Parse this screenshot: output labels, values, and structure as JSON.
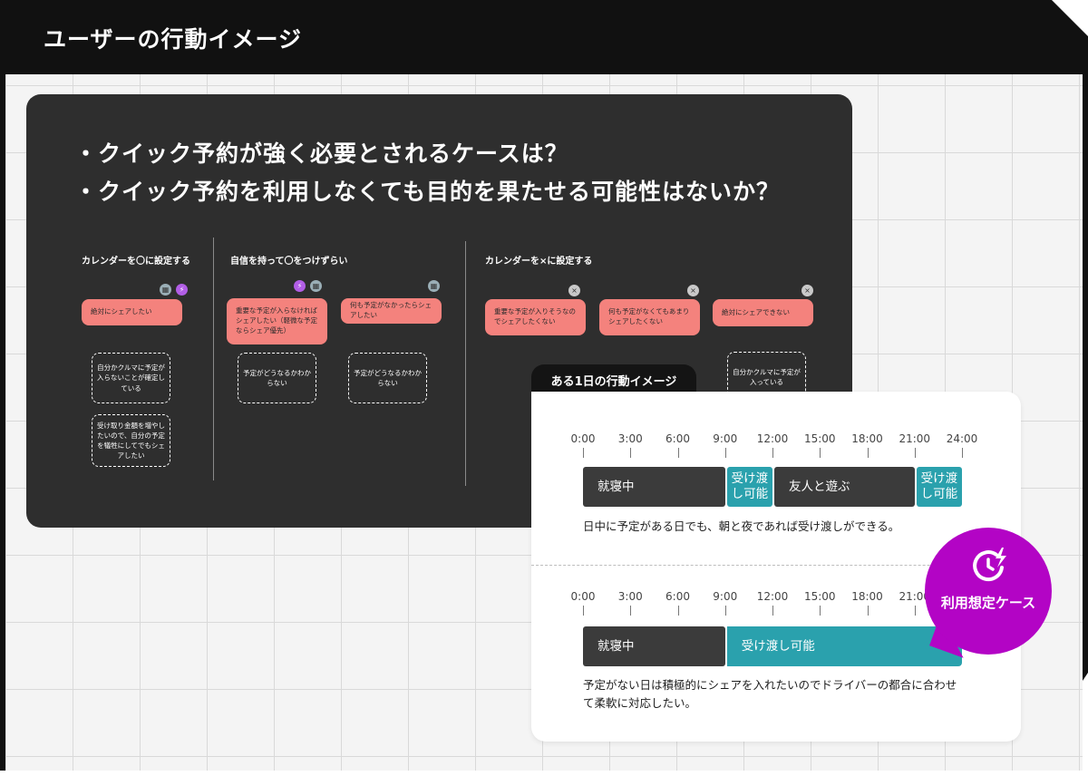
{
  "header": {
    "title": "ユーザーの行動イメージ"
  },
  "questions": [
    "・クイック予約が強く必要とされるケースは？",
    "・クイック予約を利用しなくても目的を果たせる可能性はないか？"
  ],
  "columns": [
    {
      "heading": "カレンダーを〇に設定する",
      "cards": [
        {
          "text": "絶対にシェアしたい"
        }
      ],
      "notes": [
        "自分かクルマに予定が入らないことが確定している",
        "受け取り金額を増やしたいので、自分の予定を犠牲にしてでもシェアしたい"
      ]
    },
    {
      "heading": "自信を持って〇をつけずらい",
      "cards": [
        {
          "text": "重要な予定が入らなければシェアしたい（軽微な予定ならシェア優先）"
        },
        {
          "text": "何も予定がなかったらシェアしたい"
        }
      ],
      "notes": [
        "予定がどうなるかわからない",
        "予定がどうなるかわからない"
      ]
    },
    {
      "heading": "カレンダーを×に設定する",
      "cards": [
        {
          "text": "重要な予定が入りそうなのでシェアしたくない"
        },
        {
          "text": "何も予定がなくてもあまりシェアしたくない"
        },
        {
          "text": "絶対にシェアできない"
        }
      ],
      "notes": [
        "自分かクルマに予定が入っている"
      ]
    }
  ],
  "mini_icons": {
    "calendar": "calendar-icon",
    "bolt": "lightning-icon",
    "cross": "cross-icon"
  },
  "timeline_card": {
    "tab_label": "ある1日の行動イメージ",
    "hours": [
      "0:00",
      "3:00",
      "6:00",
      "9:00",
      "12:00",
      "15:00",
      "18:00",
      "21:00",
      "24:00"
    ],
    "timelines": [
      {
        "segments": [
          {
            "label": "就寝中",
            "start": 0,
            "end": 9,
            "kind": "sleep"
          },
          {
            "label": "受け渡し可能",
            "start": 9,
            "end": 12,
            "kind": "available"
          },
          {
            "label": "友人と遊ぶ",
            "start": 12,
            "end": 21,
            "kind": "busy"
          },
          {
            "label": "受け渡し可能",
            "start": 21,
            "end": 24,
            "kind": "available"
          }
        ],
        "description": "日中に予定がある日でも、朝と夜であれば受け渡しができる。"
      },
      {
        "segments": [
          {
            "label": "就寝中",
            "start": 0,
            "end": 9,
            "kind": "sleep"
          },
          {
            "label": "受け渡し可能",
            "start": 9,
            "end": 24,
            "kind": "available"
          }
        ],
        "description": "予定がない日は積極的にシェアを入れたいのでドライバーの都合に合わせて柔軟に対応したい。"
      }
    ]
  },
  "badge": {
    "label": "利用想定ケース",
    "icon": "clock-lightning-icon"
  },
  "colors": {
    "dark_panel": "#2e2e2e",
    "pink_card": "#f4827d",
    "teal": "#2aa1ad",
    "sleep_bar": "#3b3b3b",
    "badge": "#b304c5"
  }
}
